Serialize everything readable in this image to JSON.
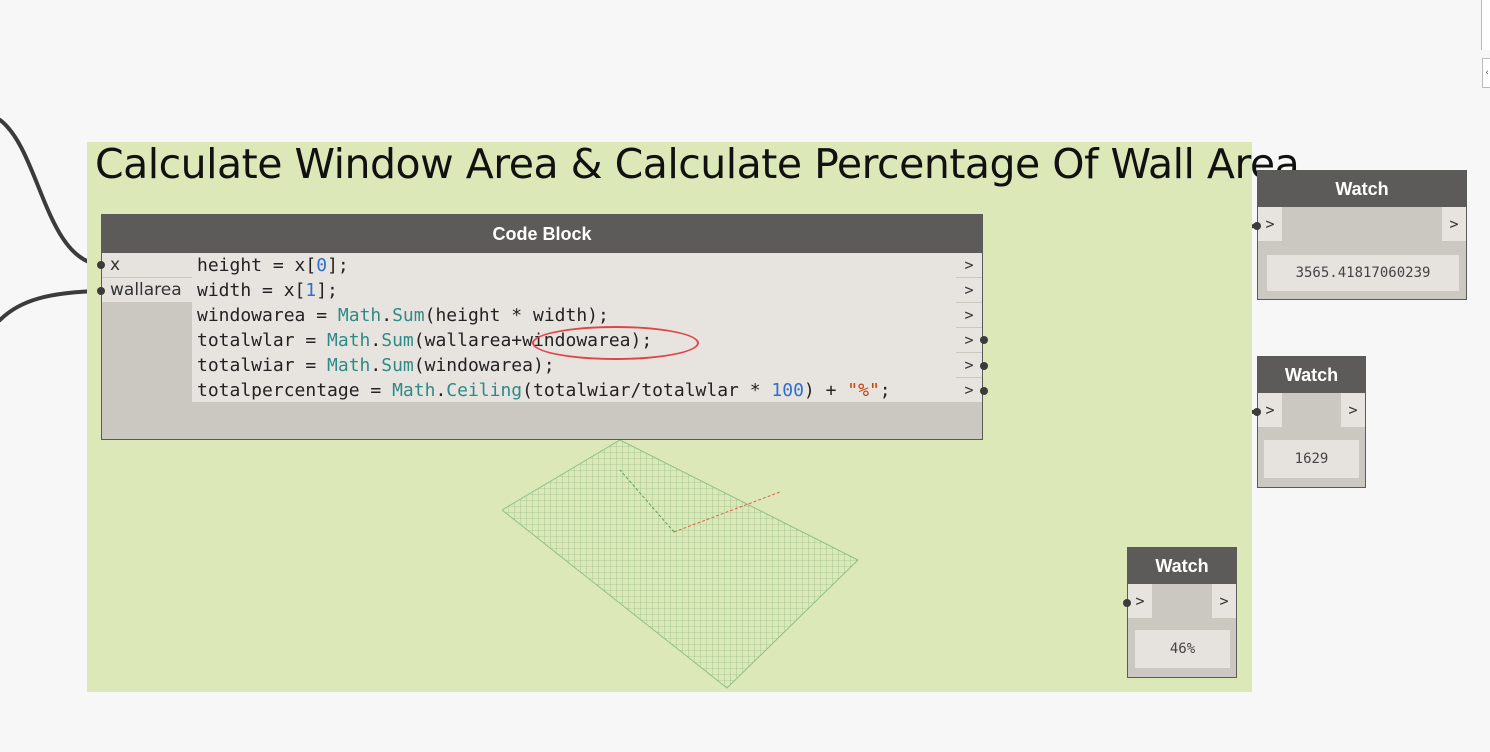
{
  "group": {
    "title": "Calculate Window Area & Calculate Percentage Of Wall Area",
    "color": "#dde8b9"
  },
  "code_block": {
    "title": "Code Block",
    "inputs": [
      "x",
      "wallarea"
    ],
    "lines": [
      "height = x[0];",
      "width = x[1];",
      "windowarea = Math.Sum(height * width);",
      "totalwlar = Math.Sum(wallarea+windowarea);",
      "totalwiar = Math.Sum(windowarea);",
      "totalpercentage = Math.Ceiling(totalwiar/totalwlar * 100) + \"%\";"
    ],
    "output_glyph": ">"
  },
  "watches": [
    {
      "title": "Watch",
      "value": "3565.41817060239"
    },
    {
      "title": "Watch",
      "value": "1629"
    },
    {
      "title": "Watch",
      "value": "46%"
    }
  ],
  "port_glyph": ">",
  "colors": {
    "header": "#5d5b59",
    "node_body": "#cbc7c1",
    "keyword": "#2e8a86",
    "number": "#2f6fcf",
    "annotation": "#e04545",
    "wire": "#3b3b3b"
  },
  "icons": [
    "scroll-collapse-icon"
  ]
}
